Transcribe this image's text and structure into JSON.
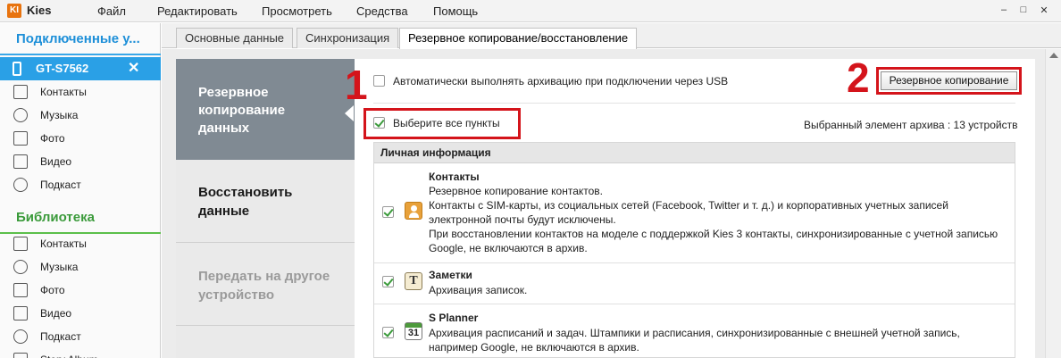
{
  "app": {
    "logo_text": "KI",
    "title": "Kies"
  },
  "menu": [
    "Файл",
    "Редактировать",
    "Просмотреть",
    "Средства",
    "Помощь"
  ],
  "window_controls": {
    "minimize": "–",
    "maximize": "□",
    "close": "✕"
  },
  "sidebar": {
    "connected_title": "Подключенные у...",
    "device": {
      "name": "GT-S7562",
      "close": "✕"
    },
    "device_items": [
      {
        "label": "Контакты",
        "icon": "contacts-icon"
      },
      {
        "label": "Музыка",
        "icon": "music-icon"
      },
      {
        "label": "Фото",
        "icon": "photo-icon"
      },
      {
        "label": "Видео",
        "icon": "video-icon"
      },
      {
        "label": "Подкаст",
        "icon": "podcast-icon"
      }
    ],
    "library_title": "Библиотека",
    "library_items": [
      {
        "label": "Контакты",
        "icon": "contacts-icon"
      },
      {
        "label": "Музыка",
        "icon": "music-icon"
      },
      {
        "label": "Фото",
        "icon": "photo-icon"
      },
      {
        "label": "Видео",
        "icon": "video-icon"
      },
      {
        "label": "Подкаст",
        "icon": "podcast-icon"
      },
      {
        "label": "Story Album",
        "icon": "album-icon"
      }
    ]
  },
  "tabs": [
    "Основные данные",
    "Синхронизация",
    "Резервное копирование/восстановление"
  ],
  "left_nav": {
    "active_line1": "Резервное",
    "active_line2": "копирование",
    "active_line3": "данных",
    "restore_line1": "Восстановить",
    "restore_line2": "данные",
    "transfer_line1": "Передать на другое",
    "transfer_line2": "устройство"
  },
  "backup": {
    "auto_label": "Автоматически выполнять архивацию при подключении через USB",
    "backup_button": "Резервное копирование",
    "select_all_label": "Выберите все пункты",
    "selected_summary": "Выбранный элемент архива :  13 устройств",
    "annotation_1": "1",
    "annotation_2": "2"
  },
  "list": {
    "section_title": "Личная информация",
    "contacts": {
      "title": "Контакты",
      "lines": [
        "Резервное копирование контактов.",
        "Контакты с SIM-карты, из социальных сетей (Facebook, Twitter и т. д.) и корпоративных учетных записей",
        "электронной почты будут исключены.",
        "При восстановлении контактов на моделе с поддержкой Kies 3 контакты, синхронизированные с учетной записью",
        "Google, не включаются в архив."
      ]
    },
    "notes": {
      "title": "Заметки",
      "lines": [
        "Архивация записок."
      ],
      "icon_letter": "T"
    },
    "planner": {
      "title": "S Planner",
      "lines": [
        "Архивация расписаний и задач. Штампики и расписания, синхронизированные с внешней учетной запись,",
        "например Google, не включаются в архив."
      ],
      "icon_number": "31"
    }
  },
  "colors": {
    "accent_blue": "#2aa0e6",
    "library_green": "#3a9a3a",
    "annotation_red": "#d4141b",
    "nav_active": "#808a93"
  }
}
